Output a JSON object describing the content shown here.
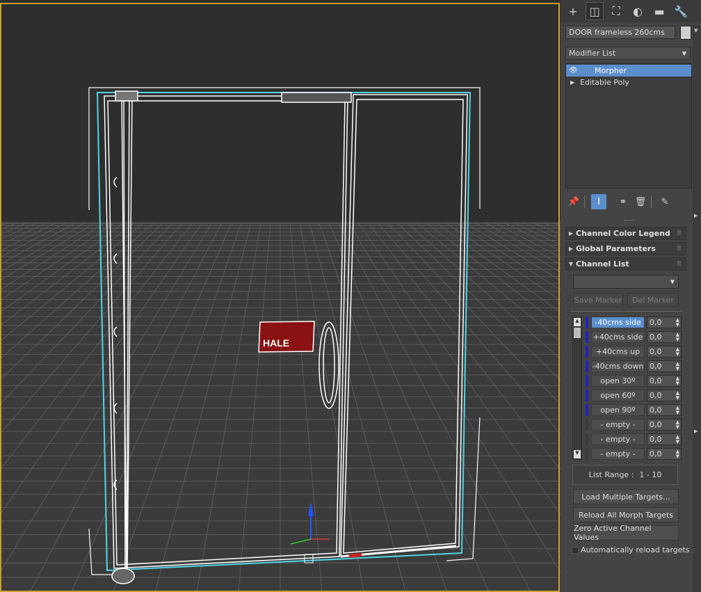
{
  "command_panel": {
    "tabs": [
      {
        "name": "create",
        "glyph": "+"
      },
      {
        "name": "modify",
        "glyph": "◫"
      },
      {
        "name": "hierarchy",
        "glyph": "⛶"
      },
      {
        "name": "motion",
        "glyph": "◐"
      },
      {
        "name": "display",
        "glyph": "▬"
      },
      {
        "name": "utilities",
        "glyph": "🔧"
      }
    ],
    "object_name": "DOOR frameless 260cms",
    "object_color": "#cfcfcf",
    "modifier_list_label": "Modifier List",
    "stack": [
      {
        "label": "Morpher",
        "selected": true,
        "eye": true
      },
      {
        "label": "Editable Poly",
        "selected": false,
        "eye": false
      }
    ]
  },
  "rollouts": {
    "channel_color_legend": "Channel Color Legend",
    "global_parameters": "Global Parameters",
    "channel_list": "Channel List"
  },
  "channel_list": {
    "marker_dropdown_value": "",
    "save_marker": "Save Marker",
    "del_marker": "Del Marker",
    "channels": [
      {
        "name": "-40cms side",
        "value": "0,0",
        "color": "#2222bb",
        "selected": true
      },
      {
        "name": "+40cms side",
        "value": "0,0",
        "color": "#2222bb",
        "selected": false
      },
      {
        "name": "+40cms up",
        "value": "0,0",
        "color": "#2222bb",
        "selected": false
      },
      {
        "name": "-40cms down",
        "value": "0,0",
        "color": "#2222bb",
        "selected": false
      },
      {
        "name": "open 30º",
        "value": "0,0",
        "color": "#2222bb",
        "selected": false
      },
      {
        "name": "open 60º",
        "value": "0,0",
        "color": "#2222bb",
        "selected": false
      },
      {
        "name": "open 90º",
        "value": "0,0",
        "color": "#2222bb",
        "selected": false
      },
      {
        "name": "- empty -",
        "value": "0,0",
        "color": "#3a3a3a",
        "selected": false
      },
      {
        "name": "- empty -",
        "value": "0,0",
        "color": "#3a3a3a",
        "selected": false
      },
      {
        "name": "- empty -",
        "value": "0,0",
        "color": "#3a3a3a",
        "selected": false
      }
    ],
    "list_range_label": "List Range :",
    "list_range_value": "1 - 10",
    "load_multiple_targets": "Load Multiple Targets...",
    "reload_all_morph_targets": "Reload All Morph Targets",
    "zero_active_channel_values": "Zero Active Channel Values",
    "auto_reload_label": "Automatically reload targets",
    "auto_reload_checked": false
  },
  "viewport": {
    "sign_text": "HALE",
    "selection_color": "#4fd6e6",
    "wire_color": "#ffffff",
    "sign_color": "#8a1212"
  }
}
